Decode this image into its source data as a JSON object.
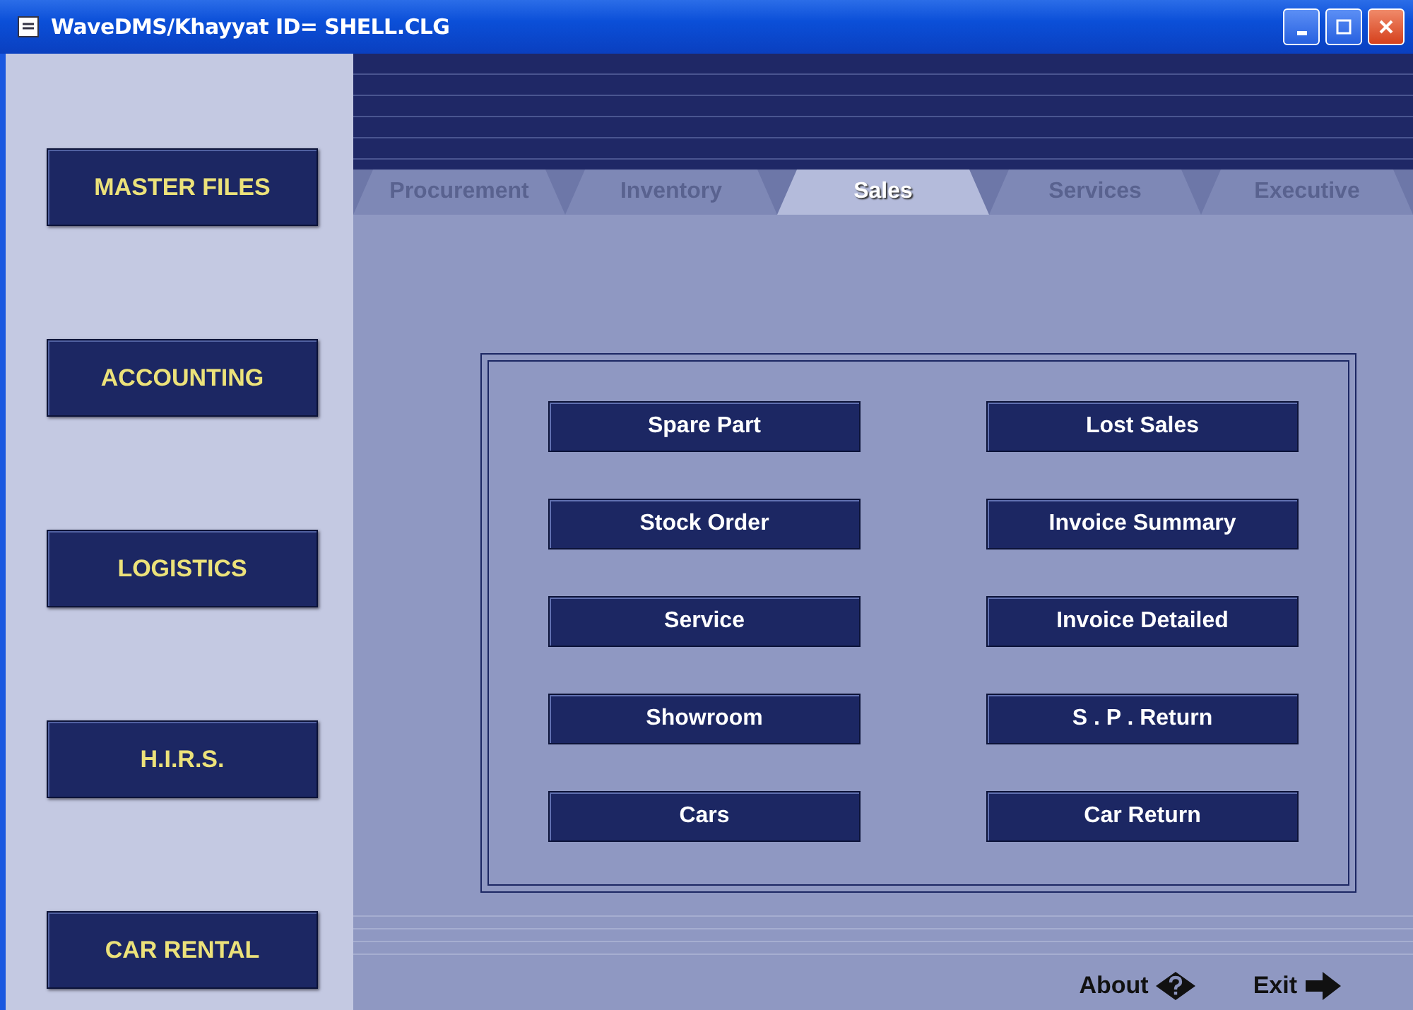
{
  "window": {
    "title": "WaveDMS/Khayyat ID= SHELL.CLG"
  },
  "sidebar": {
    "items": [
      {
        "label": "MASTER FILES"
      },
      {
        "label": "ACCOUNTING"
      },
      {
        "label": "LOGISTICS"
      },
      {
        "label": "H.I.R.S."
      },
      {
        "label": "CAR RENTAL"
      }
    ]
  },
  "tabs": [
    {
      "label": "Procurement",
      "selected": false
    },
    {
      "label": "Inventory",
      "selected": false
    },
    {
      "label": "Sales",
      "selected": true
    },
    {
      "label": "Services",
      "selected": false
    },
    {
      "label": "Executive",
      "selected": false
    }
  ],
  "reports": [
    {
      "label": "Spare Part"
    },
    {
      "label": "Lost Sales"
    },
    {
      "label": "Stock Order"
    },
    {
      "label": "Invoice Summary"
    },
    {
      "label": "Service"
    },
    {
      "label": "Invoice Detailed"
    },
    {
      "label": "Showroom"
    },
    {
      "label": "S . P . Return"
    },
    {
      "label": "Cars"
    },
    {
      "label": "Car Return"
    }
  ],
  "footer": {
    "about": "About",
    "exit": "Exit"
  }
}
